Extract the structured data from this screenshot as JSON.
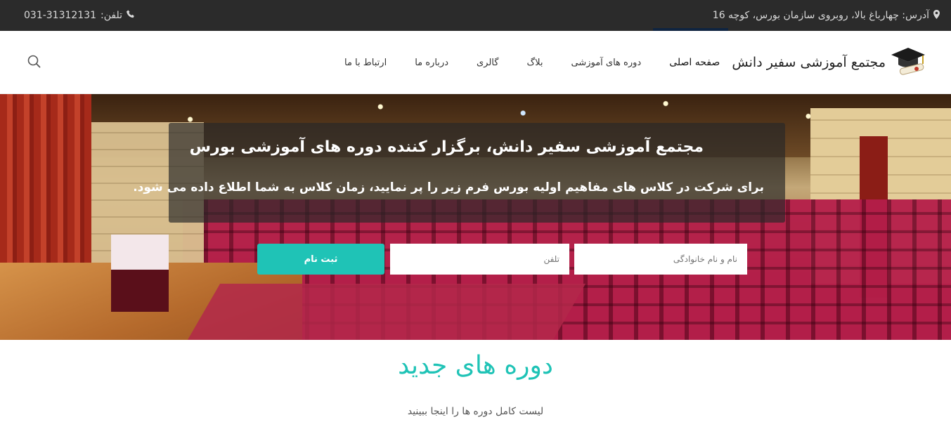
{
  "topbar": {
    "address": "آدرس: چهارباغ بالا، روبروی سازمان بورس، کوچه 16",
    "phone_label": "تلفن:",
    "phone_number": "031-31312131"
  },
  "logo": {
    "text": "مجتمع آموزشی سفیر دانش"
  },
  "nav": {
    "items": [
      {
        "label": "صفحه اصلی"
      },
      {
        "label": "دوره های آموزشی"
      },
      {
        "label": "بلاگ"
      },
      {
        "label": "گالری"
      },
      {
        "label": "درباره ما"
      },
      {
        "label": "ارتباط با ما"
      }
    ]
  },
  "hero": {
    "title": "مجتمع آموزشی سفیر دانش، برگزار کننده دوره های آموزشی بورس",
    "subtitle": "برای شرکت در کلاس های مفاهیم اولیه بورس فرم زیر را پر نمایید، زمان کلاس به شما اطلاع داده می شود.",
    "form": {
      "name_placeholder": "نام و نام خانوادگی",
      "phone_placeholder": "تلفن",
      "submit_label": "ثبت نام"
    }
  },
  "courses": {
    "title": "دوره های جدید",
    "subtitle": "لیست کامل دوره ها را اینجا ببینید"
  },
  "colors": {
    "accent": "#1fc3b6",
    "topbar": "#2b2b2b"
  },
  "icons": [
    "map-marker-icon",
    "phone-icon",
    "graduation-cap-icon",
    "search-icon"
  ]
}
